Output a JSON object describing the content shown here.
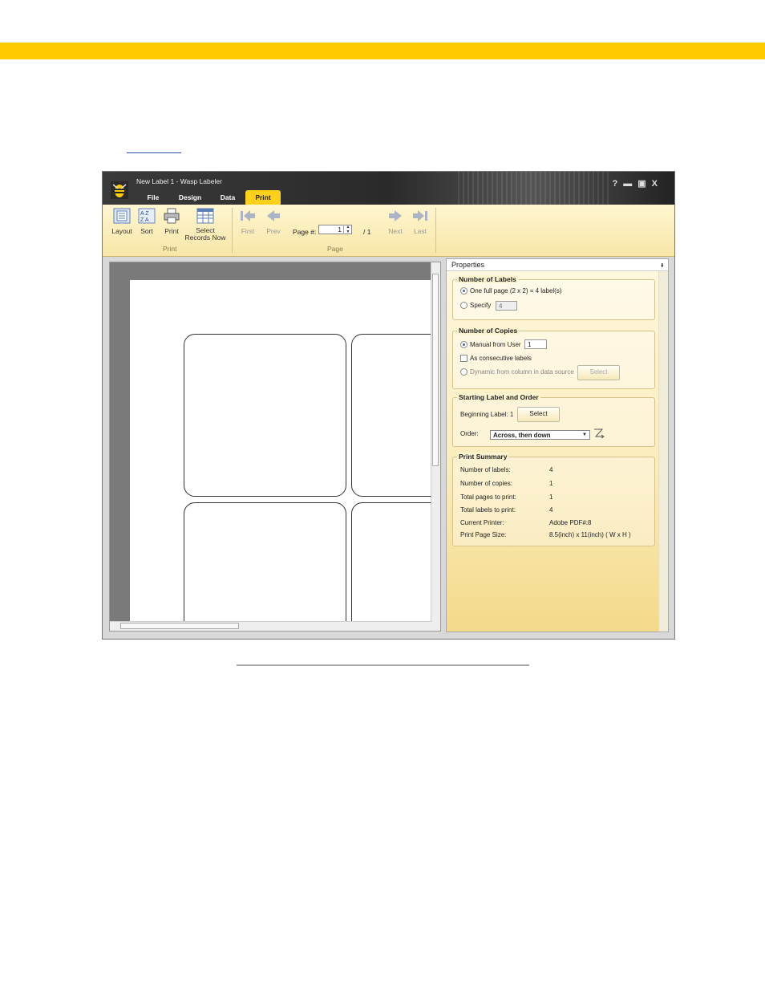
{
  "window": {
    "title": "New Label 1 - Wasp Labeler",
    "tabs": [
      "File",
      "Design",
      "Data",
      "Print"
    ],
    "active_tab": "Print",
    "controls": {
      "help": "?",
      "minimize": "▬",
      "maximize": "▣",
      "close": "X"
    }
  },
  "ribbon": {
    "print_group": {
      "label": "Print",
      "buttons": [
        "Layout",
        "Sort",
        "Print",
        "Select Records Now"
      ]
    },
    "page_group": {
      "label": "Page",
      "first": "First",
      "prev": "Prev",
      "page_label": "Page #:",
      "page_value": "1",
      "page_total": "/  1",
      "next": "Next",
      "last": "Last"
    }
  },
  "properties": {
    "header": "Properties",
    "pin": "ᵻ",
    "number_of_labels": {
      "title": "Number of Labels",
      "option_full": "One full page (2 x 2) = 4 label(s)",
      "option_specify": "Specify",
      "specify_value": "4"
    },
    "number_of_copies": {
      "title": "Number of Copies",
      "manual": "Manual from User",
      "manual_value": "1",
      "consecutive": "As consecutive labels",
      "dynamic": "Dynamic from column in data source",
      "select": "Select"
    },
    "starting_label": {
      "title": "Starting Label and Order",
      "beginning": "Beginning Label: 1",
      "select": "Select",
      "order_label": "Order:",
      "order_value": "Across, then down"
    },
    "print_summary": {
      "title": "Print Summary",
      "rows": [
        {
          "k": "Number of labels:",
          "v": "4"
        },
        {
          "k": "Number of copies:",
          "v": "1"
        },
        {
          "k": "Total pages to print:",
          "v": "1"
        },
        {
          "k": "Total labels to print:",
          "v": "4"
        },
        {
          "k": "Current Printer:",
          "v": "Adobe PDF#:8"
        },
        {
          "k": "Print Page Size:",
          "v": "8.5(inch) x 11(inch) ( W x H )"
        }
      ]
    }
  },
  "colors": {
    "accent": "#ffcc00",
    "ribbon": "#fff6d0",
    "panel": "#fbecbb"
  }
}
